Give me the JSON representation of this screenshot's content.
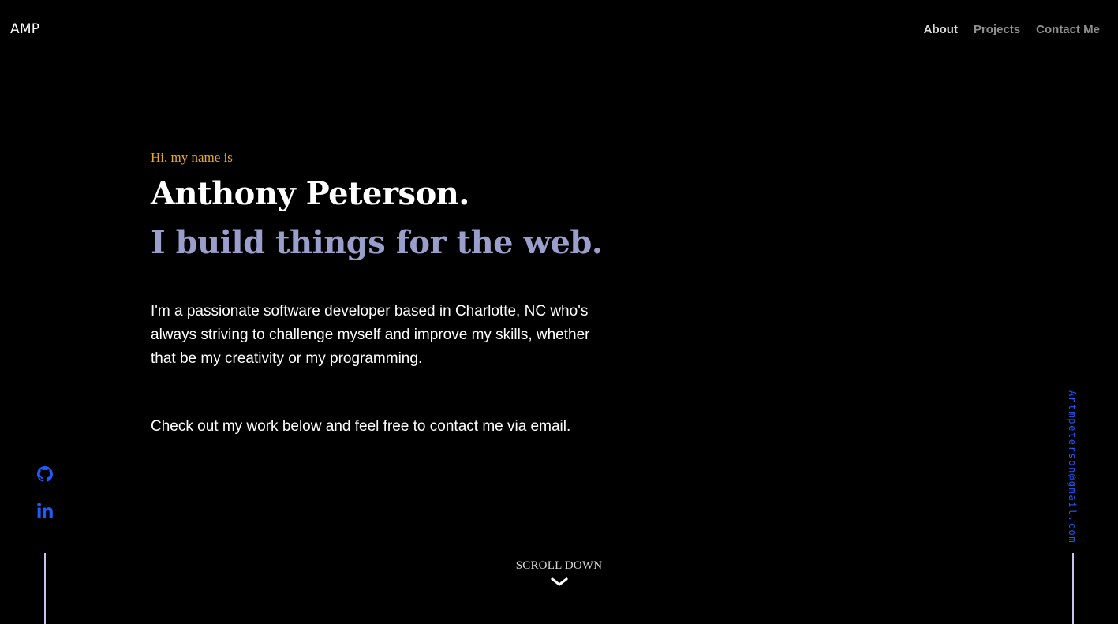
{
  "header": {
    "logo": "AMP",
    "nav": [
      {
        "label": "About",
        "active": true
      },
      {
        "label": "Projects",
        "active": false
      },
      {
        "label": "Contact Me",
        "active": false
      }
    ]
  },
  "hero": {
    "greeting": "Hi, my name is",
    "name": "Anthony Peterson.",
    "tagline": "I build things for the web.",
    "bio": "I'm a passionate software developer based in Charlotte, NC who's always striving to challenge myself and improve my skills, whether that be my creativity or my programming.",
    "cta": "Check out my work below and feel free to contact me via email."
  },
  "social": {
    "links": [
      {
        "icon": "github-icon"
      },
      {
        "icon": "linkedin-icon"
      }
    ]
  },
  "email": "Antmpeterson@gmail.com",
  "scroll": {
    "label": "SCROLL DOWN",
    "icon": "chevron-down-icon"
  },
  "colors": {
    "background": "#000000",
    "accent": "#e8a82b",
    "tagline": "#9a9ecb",
    "link": "#1f5bff",
    "side_lines": "#c3c6f0"
  }
}
